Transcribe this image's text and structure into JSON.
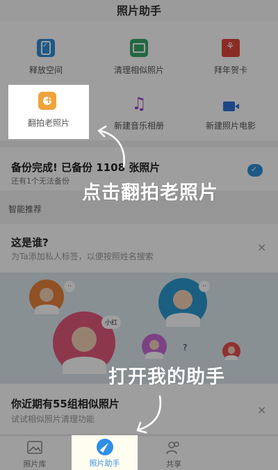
{
  "header": {
    "title": "照片助手"
  },
  "tools": [
    {
      "label": "释放空间",
      "icon": "phone-check-icon"
    },
    {
      "label": "清理相似照片",
      "icon": "photo-icon"
    },
    {
      "label": "拜年贺卡",
      "icon": "greeting-card-icon"
    },
    {
      "label": "翻拍老照片",
      "icon": "camera-plus-icon"
    },
    {
      "label": "新建音乐相册",
      "icon": "music-note-icon"
    },
    {
      "label": "新建照片电影",
      "icon": "movie-camera-icon"
    }
  ],
  "backup": {
    "title": "备份完成! 已备份 1108 张照片",
    "subtitle": "还有1个无法备份"
  },
  "section_title": "智能推荐",
  "who_card": {
    "title": "这是谁?",
    "subtitle": "为Ta添加私人标签，以便按照姓名搜索",
    "close": "×"
  },
  "face_tags": {
    "xiaohong": "小红"
  },
  "similar_card": {
    "title": "你近期有55组相似照片",
    "subtitle": "试试相似照片清理功能",
    "close": "×"
  },
  "tabs": [
    {
      "label": "照片库",
      "icon": "gallery-icon"
    },
    {
      "label": "照片助手",
      "icon": "compass-icon"
    },
    {
      "label": "共享",
      "icon": "people-icon"
    }
  ],
  "captions": {
    "tap_remake": "点击翻拍老照片",
    "open_assistant": "打开我的助手"
  },
  "colors": {
    "accent": "#2f8fe6",
    "camera": "#f0a33a",
    "card": "#e0473a",
    "music": "#9b3fcf"
  }
}
